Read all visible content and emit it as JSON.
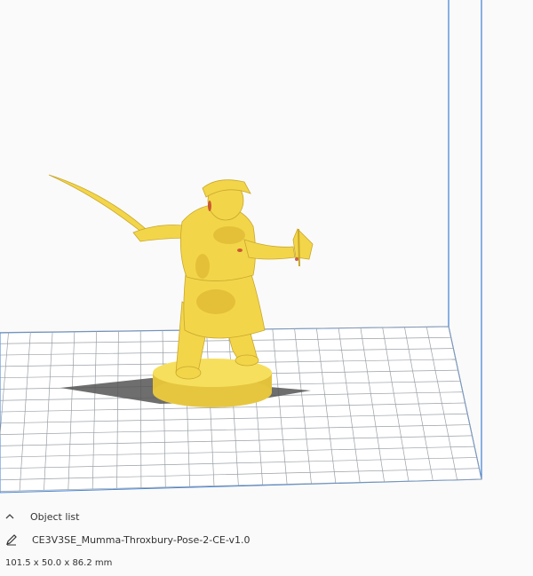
{
  "viewport": {
    "model_color": "#f3d54a",
    "plate_color": "#ffffff",
    "grid_color": "#9aa0a6",
    "volume_edge_color": "#3d7fd6"
  },
  "object_panel": {
    "header_label": "Object list",
    "object_name": "CE3V3SE_Mumma-Throxbury-Pose-2-CE-v1.0",
    "dimensions": "101.5 x 50.0 x 86.2 mm",
    "icons": {
      "collapse": "chevron-up-icon",
      "rename": "pencil-icon"
    }
  }
}
